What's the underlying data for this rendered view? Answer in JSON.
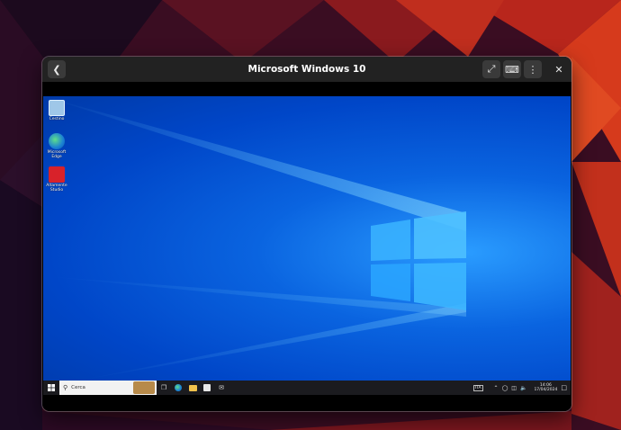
{
  "window": {
    "title": "Microsoft Windows 10"
  },
  "desktop_icons": [
    {
      "label": "Cestino",
      "icon": "recycle-bin-icon"
    },
    {
      "label": "Microsoft Edge",
      "icon": "edge-icon"
    },
    {
      "label": "Altamente Studio",
      "icon": "app-red-icon"
    }
  ],
  "taskbar": {
    "search_placeholder": "Cerca",
    "tray_keyboard": "ITA",
    "time": "14:06",
    "date": "17/04/2024"
  },
  "colors": {
    "desktop_blue": "#0a64e0",
    "taskbar": "#1b1b1f",
    "headerbar": "#222222"
  }
}
